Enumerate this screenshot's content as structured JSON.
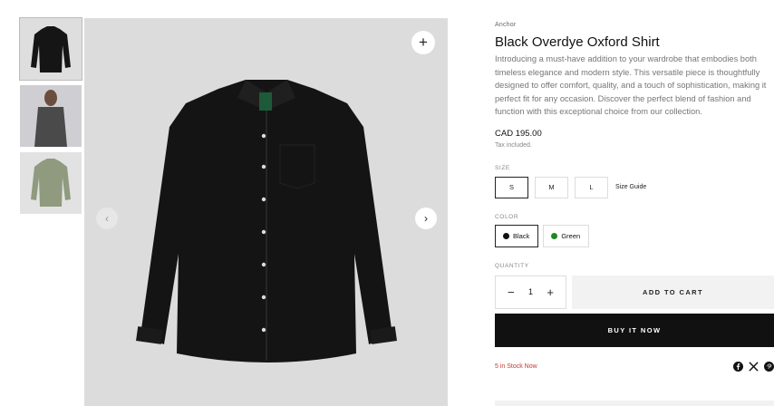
{
  "gallery": {
    "thumbnails": [
      {
        "name": "black-shirt-flat",
        "color": "#151515"
      },
      {
        "name": "model-wearing-shirt",
        "color": "#4a4a4a"
      },
      {
        "name": "green-shirt-flat",
        "color": "#8f9a7e"
      }
    ],
    "zoom_icon": "+",
    "prev_icon": "‹",
    "next_icon": "›"
  },
  "product": {
    "vendor": "Anchor",
    "title": "Black Overdye Oxford Shirt",
    "description": "Introducing a must-have addition to your wardrobe that embodies both timeless elegance and modern style. This versatile piece is thoughtfully designed to offer comfort, quality, and a touch of sophistication, making it perfect fit for any occasion. Discover the perfect blend of fashion and function with this exceptional choice from our collection.",
    "price": "CAD 195.00",
    "tax_note": "Tax included.",
    "size_label": "SIZE",
    "sizes": [
      "S",
      "M",
      "L"
    ],
    "selected_size": "S",
    "size_guide": "Size Guide",
    "color_label": "COLOR",
    "colors": [
      {
        "name": "Black",
        "swatch": "#111111"
      },
      {
        "name": "Green",
        "swatch": "#1c8a1c"
      }
    ],
    "selected_color": "Black",
    "quantity_label": "QUANTITY",
    "quantity": "1",
    "qty_minus": "−",
    "qty_plus": "+",
    "add_to_cart": "ADD TO CART",
    "buy_now": "BUY IT NOW",
    "stock": "5 in Stock Now",
    "stock_color": "#c0392b"
  },
  "social": [
    "facebook-icon",
    "x-icon",
    "pinterest-icon"
  ]
}
